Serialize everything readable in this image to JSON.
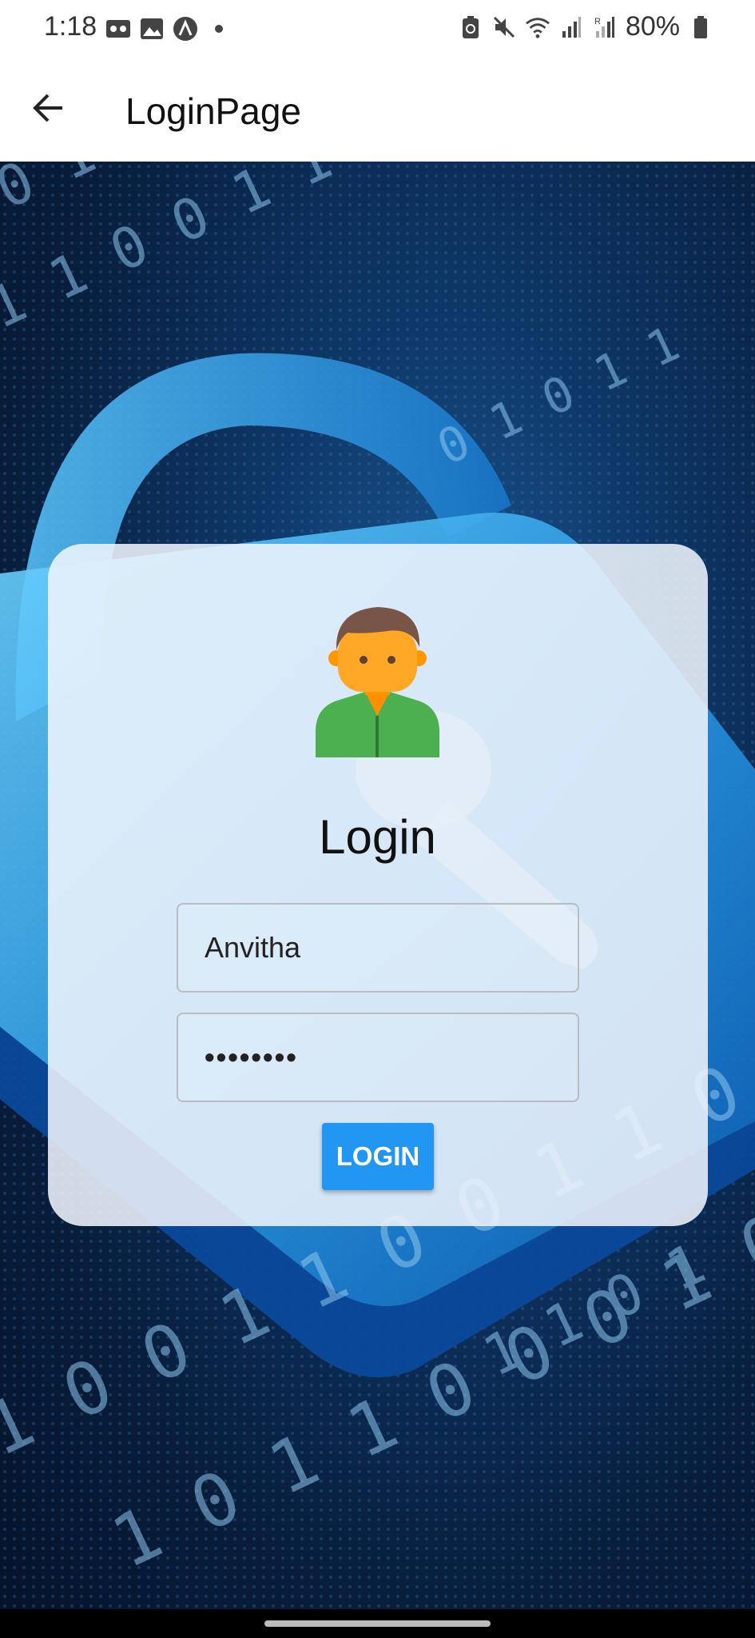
{
  "status_bar": {
    "time": "1:18",
    "battery_text": "80%",
    "left_icons": [
      "voicemail-icon",
      "image-icon",
      "app-a-icon",
      "dot-icon"
    ],
    "right_icons": [
      "battery-saver-icon",
      "mute-icon",
      "wifi-icon",
      "signal-icon",
      "signal-roaming-icon",
      "battery-icon"
    ]
  },
  "app_bar": {
    "title": "LoginPage",
    "back_icon": "arrow-back-icon"
  },
  "login_card": {
    "title": "Login",
    "avatar_icon": "person-avatar-icon",
    "username_value": "Anvitha",
    "password_value": "••••••••",
    "button_label": "LOGIN"
  },
  "colors": {
    "button": "#2196f3",
    "card": "#eef4fc",
    "avatar_shirt": "#4caf50",
    "avatar_skin": "#ffa726",
    "avatar_hair": "#795548"
  }
}
